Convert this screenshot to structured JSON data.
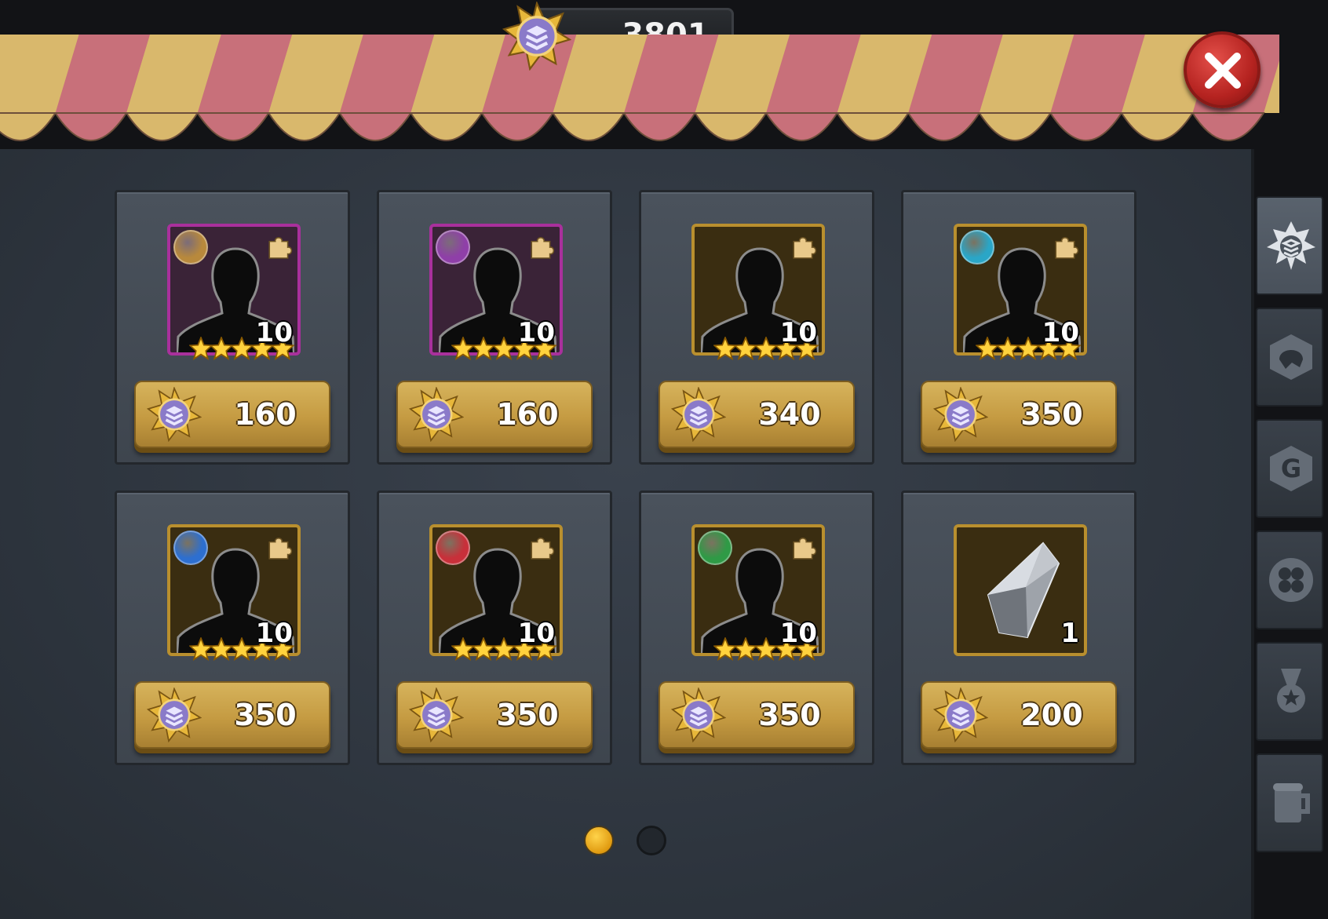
{
  "header": {
    "currency_amount": "3801"
  },
  "shop": {
    "items": [
      {
        "type": "hero-shard",
        "frame": "purple",
        "faction_color": "#b8893c",
        "quantity": "10",
        "price": "160"
      },
      {
        "type": "hero-shard",
        "frame": "purple",
        "faction_color": "#8f3fa8",
        "quantity": "10",
        "price": "160"
      },
      {
        "type": "hero-shard",
        "frame": "gold",
        "faction_color": "",
        "quantity": "10",
        "price": "340"
      },
      {
        "type": "hero-shard",
        "frame": "gold",
        "faction_color": "#2aa6c7",
        "quantity": "10",
        "price": "350"
      },
      {
        "type": "hero-shard",
        "frame": "gold",
        "faction_color": "#2d6fd0",
        "quantity": "10",
        "price": "350"
      },
      {
        "type": "hero-shard",
        "frame": "gold",
        "faction_color": "#c8303a",
        "quantity": "10",
        "price": "350"
      },
      {
        "type": "hero-shard",
        "frame": "gold",
        "faction_color": "#2f9a46",
        "quantity": "10",
        "price": "350"
      },
      {
        "type": "crystal",
        "frame": "gold",
        "faction_color": "",
        "quantity": "1",
        "price": "200"
      }
    ]
  },
  "pagination": {
    "current": 1,
    "total": 2
  },
  "side_tabs": [
    {
      "icon": "medal-star-icon",
      "active": true
    },
    {
      "icon": "helmet-hexagon-icon",
      "active": false
    },
    {
      "icon": "guild-g-icon",
      "active": false
    },
    {
      "icon": "clover-icon",
      "active": false
    },
    {
      "icon": "medal-ribbon-icon",
      "active": false
    },
    {
      "icon": "beer-mug-icon",
      "active": false
    }
  ],
  "colors": {
    "awning_red": "#c8707a",
    "awning_gold": "#d9b86c",
    "price_button": "#c59b42",
    "close_button": "#c62e29"
  }
}
